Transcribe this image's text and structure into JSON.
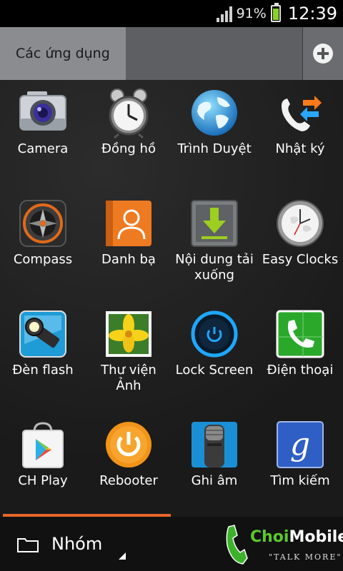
{
  "status_bar": {
    "battery_percent": "91%",
    "battery_level": 0.91,
    "time": "12:39",
    "signal_bars": 4
  },
  "header": {
    "apps_tab_label": "Các ứng dụng",
    "add_icon": "plus-circle-icon"
  },
  "apps": [
    {
      "label": "Camera",
      "icon": "camera-icon"
    },
    {
      "label": "Đồng hồ",
      "icon": "alarm-clock-icon"
    },
    {
      "label": "Trình Duyệt",
      "icon": "globe-icon"
    },
    {
      "label": "Nhật ký",
      "icon": "call-log-icon"
    },
    {
      "label": "Compass",
      "icon": "compass-icon"
    },
    {
      "label": "Danh bạ",
      "icon": "contacts-icon"
    },
    {
      "label": "Nội dung tải xuống",
      "icon": "download-icon"
    },
    {
      "label": "Easy Clocks",
      "icon": "world-clock-icon"
    },
    {
      "label": "Đèn flash",
      "icon": "flashlight-icon"
    },
    {
      "label": "Thư viện Ảnh",
      "icon": "gallery-icon"
    },
    {
      "label": "Lock Screen",
      "icon": "power-ring-icon"
    },
    {
      "label": "Điện thoại",
      "icon": "phone-icon"
    },
    {
      "label": "CH Play",
      "icon": "play-store-icon"
    },
    {
      "label": "Rebooter",
      "icon": "power-button-icon"
    },
    {
      "label": "Ghi âm",
      "icon": "microphone-icon"
    },
    {
      "label": "Tìm kiếm",
      "icon": "google-search-icon"
    }
  ],
  "page_progress": 0.5,
  "footer": {
    "group_label": "Nhóm",
    "folder_icon": "folder-icon"
  },
  "watermark": {
    "brand_a": "Choi",
    "brand_b": "Mobile",
    "tagline": "\"TALK MORE\""
  },
  "colors": {
    "accent": "#e8662a",
    "battery": "#8ad12b"
  }
}
